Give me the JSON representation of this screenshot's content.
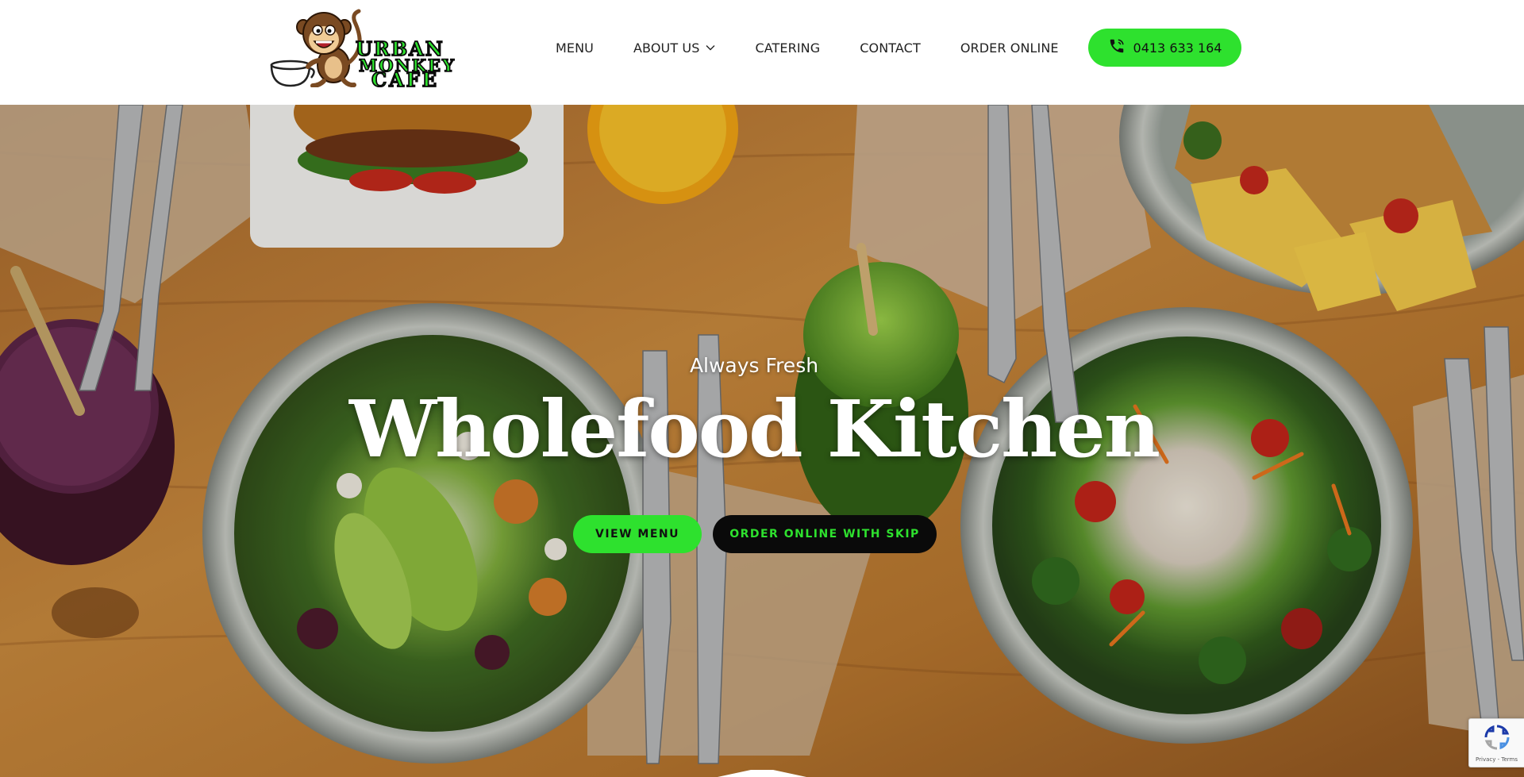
{
  "brand": {
    "name_line1": "URBAN",
    "name_line2": "MONKEY",
    "name_line3": "CAFE",
    "accent": "#2ee12e",
    "dark": "#0a0a0a"
  },
  "nav": {
    "items": [
      {
        "label": "MENU",
        "has_dropdown": false
      },
      {
        "label": "ABOUT US",
        "has_dropdown": true
      },
      {
        "label": "CATERING",
        "has_dropdown": false
      },
      {
        "label": "CONTACT",
        "has_dropdown": false
      },
      {
        "label": "ORDER ONLINE",
        "has_dropdown": false
      }
    ],
    "phone": "0413 633 164",
    "phone_icon": "phone-icon"
  },
  "hero": {
    "eyebrow": "Always Fresh",
    "title": "Wholefood Kitchen",
    "primary_cta": "VIEW MENU",
    "secondary_cta": "ORDER ONLINE WITH SKIP"
  },
  "recaptcha": {
    "links": "Privacy - Terms",
    "icon": "recaptcha-icon"
  }
}
